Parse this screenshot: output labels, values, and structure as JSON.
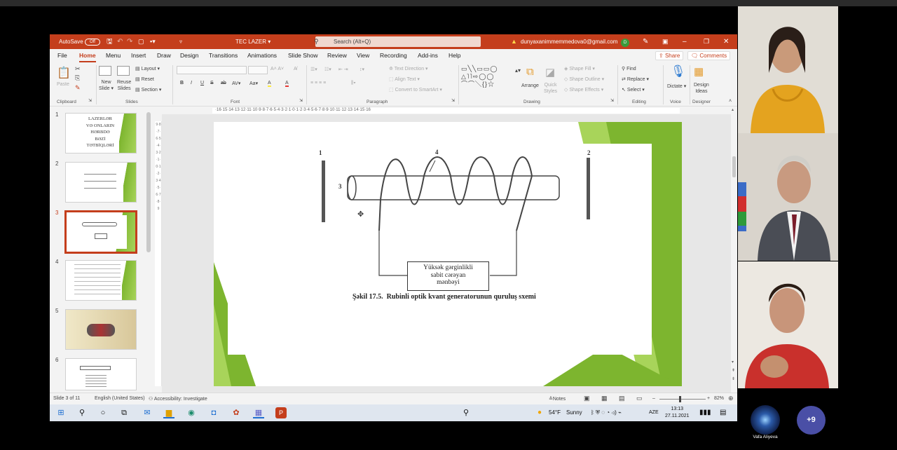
{
  "titlebar": {
    "autosave_label": "AutoSave",
    "autosave_state": "Off",
    "doc_title": "TEC LAZER",
    "search_placeholder": "Search (Alt+Q)",
    "account_email": "dunyaxanimmemmedova0@gmail.com",
    "account_initial": "D"
  },
  "menu": {
    "items": [
      "File",
      "Home",
      "Menu",
      "Insert",
      "Draw",
      "Design",
      "Transitions",
      "Animations",
      "Slide Show",
      "Review",
      "View",
      "Recording",
      "Add-ins",
      "Help"
    ],
    "active": "Home",
    "share": "Share",
    "comments": "Comments"
  },
  "ribbon": {
    "clipboard": {
      "paste": "Paste",
      "group": "Clipboard"
    },
    "slides": {
      "new_slide": "New",
      "new_slide2": "Slide",
      "reuse": "Reuse",
      "reuse2": "Slides",
      "layout": "Layout",
      "reset": "Reset",
      "section": "Section",
      "group": "Slides"
    },
    "font": {
      "group": "Font",
      "bold": "B",
      "italic": "I",
      "underline": "U",
      "strike": "S",
      "shadow": "ab",
      "spacing": "AV",
      "case": "Aa",
      "highlight": "A",
      "color": "A"
    },
    "paragraph": {
      "group": "Paragraph",
      "text_direction": "Text Direction",
      "align_text": "Align Text",
      "convert": "Convert to SmartArt"
    },
    "drawing": {
      "group": "Drawing",
      "arrange": "Arrange",
      "quick": "Quick",
      "styles": "Styles",
      "fill": "Shape Fill",
      "outline": "Shape Outline",
      "effects": "Shape Effects"
    },
    "editing": {
      "group": "Editing",
      "find": "Find",
      "replace": "Replace",
      "select": "Select"
    },
    "voice": {
      "group": "Voice",
      "dictate": "Dictate"
    },
    "designer": {
      "group": "Designer",
      "ideas": "Design",
      "ideas2": "Ideas"
    }
  },
  "ruler": {
    "h": "·16·15·14·13·12·11·10·9·8·7·6·5·4·3·2·1·0·1·2·3·4·5·6·7·8·9·10·11·12·13·14·15·16",
    "v": "9·8·7·6·5·4·3·2·1·0·1·2·3·4·5·6·7·8·9"
  },
  "thumbnails": [
    {
      "num": "1",
      "lines": [
        "LAZERLƏR",
        "VƏ ONLARIN",
        "HƏRBDƏ",
        "BƏZİ",
        "TƏTBİQLƏRİ"
      ]
    },
    {
      "num": "2"
    },
    {
      "num": "3",
      "selected": true
    },
    {
      "num": "4"
    },
    {
      "num": "5"
    },
    {
      "num": "6"
    }
  ],
  "slide": {
    "label_1": "1",
    "label_2": "2",
    "label_3": "3",
    "label_4": "4",
    "box_text": [
      "Yüksək gərginlikli",
      "sabit cərəyan",
      "mənbəyi"
    ],
    "caption_bold": "Şəkil 17.5.",
    "caption_text": "Rubinli optik kvant generatorunun quruluş sxemi"
  },
  "status": {
    "slide_count": "Slide 3 of 11",
    "language": "English (United States)",
    "accessibility": "Accessibility: Investigate",
    "notes": "Notes",
    "zoom": "82%"
  },
  "taskbar": {
    "weather_temp": "54°F",
    "weather_text": "Sunny",
    "lang": "AZE",
    "time": "13:13",
    "date": "27.11.2021"
  },
  "call": {
    "more_count": "+9",
    "viewer_name": "Vafa Aliyeva"
  },
  "colors": {
    "accent": "#c43e1c",
    "slide_green": "#7db52f"
  }
}
